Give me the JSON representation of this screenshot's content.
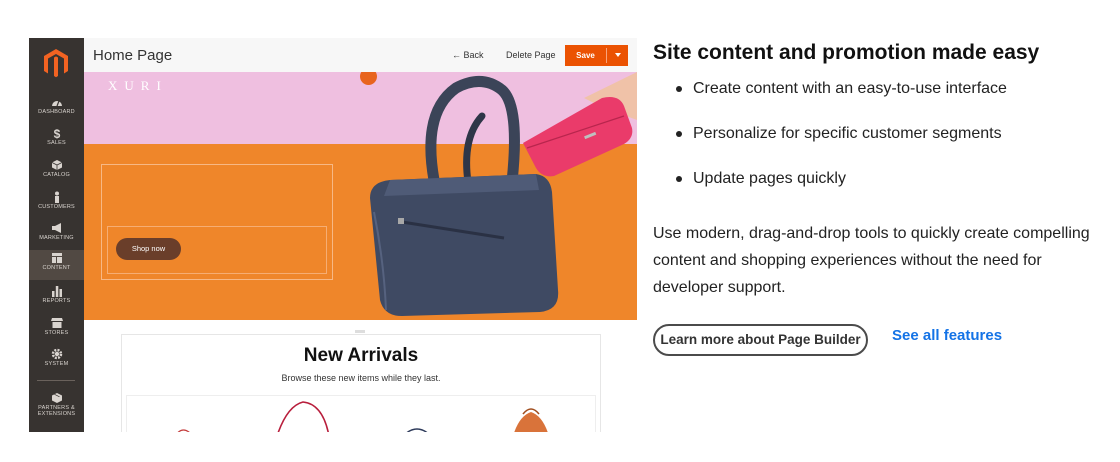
{
  "admin": {
    "nav_items": [
      {
        "label": "DASHBOARD",
        "icon": "dashboard-icon"
      },
      {
        "label": "SALES",
        "icon": "dollar-icon"
      },
      {
        "label": "CATALOG",
        "icon": "cube-icon"
      },
      {
        "label": "CUSTOMERS",
        "icon": "person-icon"
      },
      {
        "label": "MARKETING",
        "icon": "megaphone-icon"
      },
      {
        "label": "CONTENT",
        "icon": "layout-icon"
      },
      {
        "label": "REPORTS",
        "icon": "bar-chart-icon"
      },
      {
        "label": "STORES",
        "icon": "storefront-icon"
      },
      {
        "label": "SYSTEM",
        "icon": "gear-icon"
      },
      {
        "label": "PARTNERS &",
        "label2": "EXTENSIONS",
        "icon": "puzzle-cube-icon"
      }
    ],
    "active_nav": "CONTENT",
    "page_title": "Home Page",
    "back_label": "← Back",
    "delete_label": "Delete Page",
    "save_label": "Save",
    "hero": {
      "brand": "XURI",
      "shop_label": "Shop now"
    },
    "arrivals": {
      "title": "New Arrivals",
      "subtitle": "Browse these new items while they last."
    },
    "colors": {
      "sidebar": "#373330",
      "accent": "#eb5202",
      "hero_pink": "#efbfe0",
      "hero_orange": "#ef862a"
    }
  },
  "promo": {
    "heading": "Site content and promotion made easy",
    "features": [
      "Create content with an easy-to-use interface",
      "Personalize for specific customer segments",
      "Update pages quickly"
    ],
    "description": "Use modern, drag-and-drop tools to quickly create compelling content and shopping experiences without the need for developer support.",
    "learn_more_label": "Learn more about Page Builder",
    "see_all_label": "See all features",
    "link_color": "#1473e6"
  }
}
